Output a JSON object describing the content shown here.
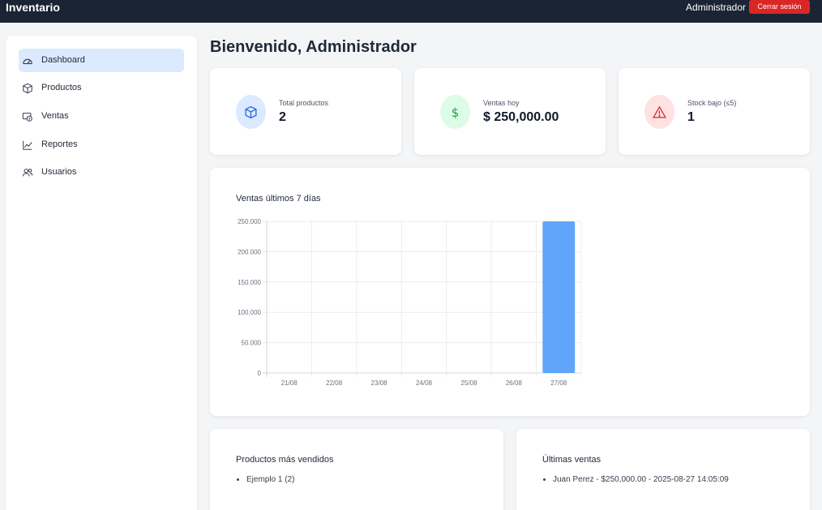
{
  "app": {
    "title": "Inventario",
    "user": "Administrador",
    "logout_label": "Cerrar sesión"
  },
  "sidebar": {
    "items": [
      {
        "label": "Dashboard",
        "icon": "gauge-icon",
        "active": true
      },
      {
        "label": "Productos",
        "icon": "box-icon"
      },
      {
        "label": "Ventas",
        "icon": "cash-icon"
      },
      {
        "label": "Reportes",
        "icon": "chart-line-icon"
      },
      {
        "label": "Usuarios",
        "icon": "users-icon"
      }
    ]
  },
  "main": {
    "title": "Bienvenido, Administrador",
    "stats": [
      {
        "label": "Total productos",
        "value": "2",
        "icon": "box-icon",
        "color": "#2563eb",
        "bg": "#dbeafe"
      },
      {
        "label": "Ventas hoy",
        "value": "$ 250,000.00",
        "icon": "dollar-icon",
        "color": "#16a34a",
        "bg": "#dcfce7"
      },
      {
        "label": "Stock bajo (≤5)",
        "value": "1",
        "icon": "warning-icon",
        "color": "#dc2626",
        "bg": "#fee2e2"
      }
    ],
    "chart_title": "Ventas últimos 7 días",
    "top_products": {
      "title": "Productos más vendidos",
      "items": [
        "Ejemplo 1 (2)"
      ]
    },
    "recent_sales": {
      "title": "Últimas ventas",
      "items": [
        "Juan Perez - $250,000.00 - 2025-08-27 14:05:09"
      ]
    }
  },
  "chart_data": {
    "type": "bar",
    "categories": [
      "21/08",
      "22/08",
      "23/08",
      "24/08",
      "25/08",
      "26/08",
      "27/08"
    ],
    "values": [
      0,
      0,
      0,
      0,
      0,
      0,
      250000
    ],
    "yticks": [
      "0",
      "50.000",
      "100.000",
      "150.000",
      "200.000",
      "250.000"
    ],
    "ylim": [
      0,
      250000
    ],
    "grid": true,
    "color": "#60a5fa"
  }
}
